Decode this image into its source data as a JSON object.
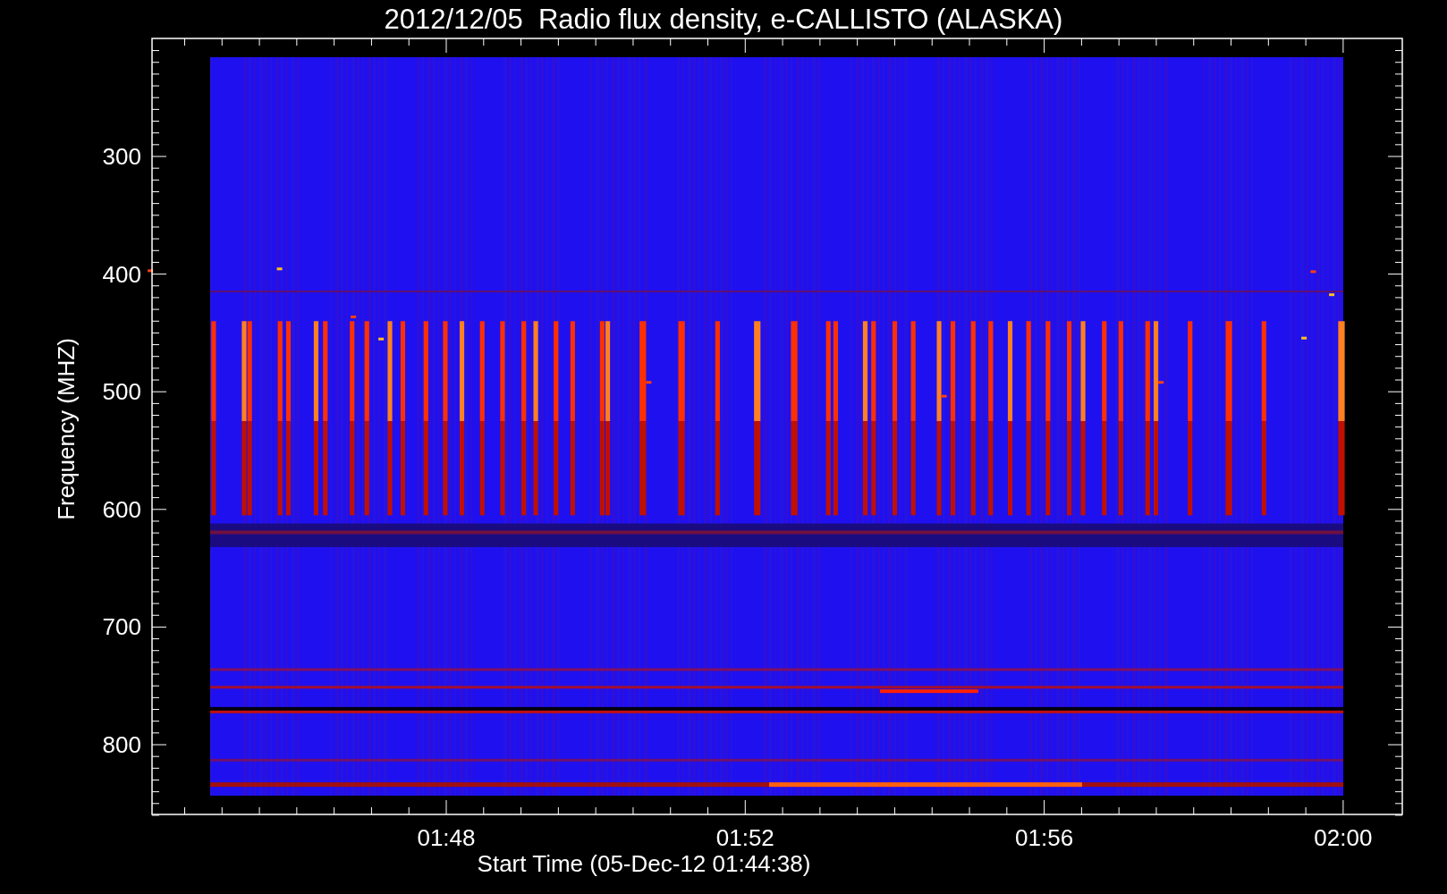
{
  "chart": {
    "title": "2012/12/05  Radio flux density, e-CALLISTO (ALASKA)",
    "ylabel": "Frequency (MHZ)",
    "yticks": [
      "300",
      "400",
      "500",
      "600",
      "700",
      "800"
    ],
    "xlabel": "Start Time (05-Dec-12 01:44:38)",
    "xticks": [
      "01:48",
      "01:52",
      "01:56",
      "02:00"
    ]
  }
}
